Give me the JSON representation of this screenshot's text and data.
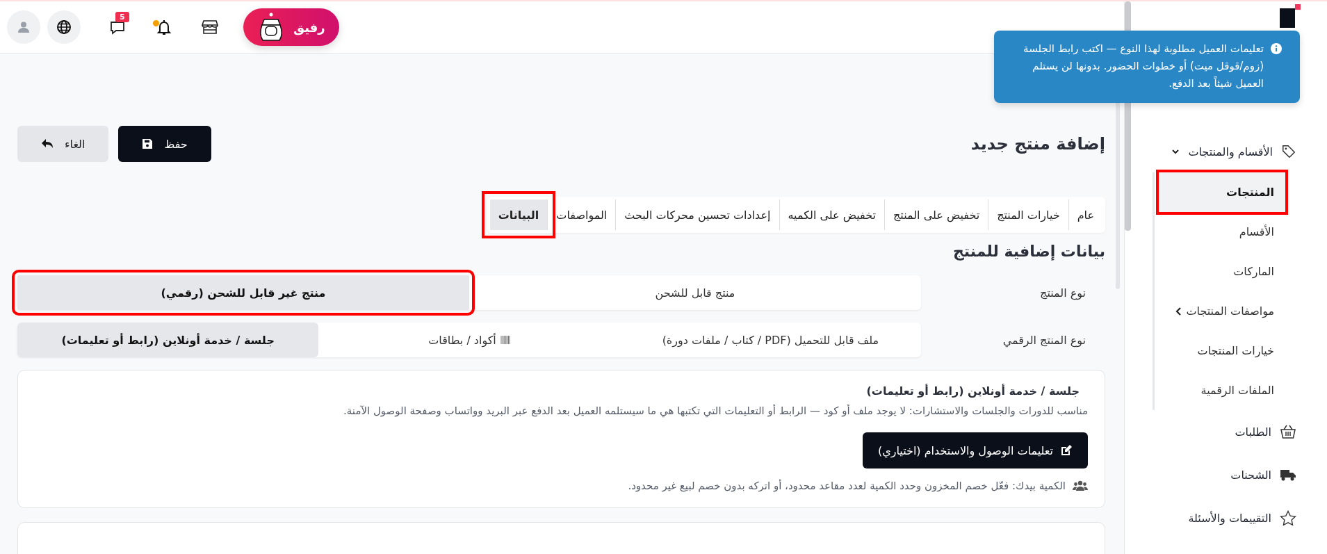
{
  "topbar": {
    "assistant": {
      "label": "رفيق"
    },
    "messages_badge": "5",
    "notification_dot": true
  },
  "sidebar": {
    "group": {
      "label": "الأقسام والمنتجات",
      "expanded": true
    },
    "subitems": [
      {
        "label": "المنتجات",
        "selected": true,
        "highlighted": true,
        "has_arrow": false
      },
      {
        "label": "الأقسام",
        "selected": false,
        "highlighted": false,
        "has_arrow": false
      },
      {
        "label": "الماركات",
        "selected": false,
        "highlighted": false,
        "has_arrow": false
      },
      {
        "label": "مواصفات المنتجات",
        "selected": false,
        "highlighted": false,
        "has_arrow": true
      },
      {
        "label": "خيارات المنتجات",
        "selected": false,
        "highlighted": false,
        "has_arrow": false
      },
      {
        "label": "الملفات الرقمية",
        "selected": false,
        "highlighted": false,
        "has_arrow": false
      }
    ],
    "items": [
      {
        "label": "الطلبات"
      },
      {
        "label": "الشحنات"
      },
      {
        "label": "التقييمات والأسئلة"
      }
    ]
  },
  "toast": {
    "text": "تعليمات العميل مطلوبة لهذا النوع — اكتب رابط الجلسة (زوم/قوقل ميت) أو خطوات الحضور. بدونها لن يستلم العميل شيئاً بعد الدفع."
  },
  "page": {
    "title": "إضافة منتج جديد",
    "buttons": [
      {
        "label": "حفظ",
        "kind": "primary"
      },
      {
        "label": "الغاء",
        "kind": "secondary"
      }
    ]
  },
  "tabs": [
    {
      "label": "عام",
      "selected": false,
      "highlighted": false
    },
    {
      "label": "خيارات المنتج",
      "selected": false,
      "highlighted": false
    },
    {
      "label": "تخفيض على المنتج",
      "selected": false,
      "highlighted": false
    },
    {
      "label": "تخفيض على الكميه",
      "selected": false,
      "highlighted": false
    },
    {
      "label": "إعدادات تحسين محركات البحث",
      "selected": false,
      "highlighted": false
    },
    {
      "label": "المواصفات",
      "selected": false,
      "highlighted": false
    },
    {
      "label": "البيانات",
      "selected": true,
      "highlighted": true
    }
  ],
  "section_title": "بيانات إضافية للمنتج",
  "form": [
    {
      "label": "نوع المنتج",
      "options": [
        {
          "label": "منتج قابل للشحن",
          "selected": false,
          "highlighted": false
        },
        {
          "label": "منتج غير قابل للشحن (رقمي)",
          "selected": true,
          "highlighted": true
        }
      ]
    },
    {
      "label": "نوع المنتج الرقمي",
      "options": [
        {
          "label": "ملف قابل للتحميل (PDF / كتاب / ملفات دورة)",
          "selected": false,
          "highlighted": false
        },
        {
          "label": "أكواد / بطاقات",
          "selected": false,
          "highlighted": false
        },
        {
          "label": "جلسة / خدمة أونلاين (رابط أو تعليمات)",
          "selected": true,
          "highlighted": false
        }
      ]
    }
  ],
  "card": {
    "title": "جلسة / خدمة أونلاين (رابط أو تعليمات)",
    "description": "مناسب للدورات والجلسات والاستشارات: لا يوجد ملف أو كود — الرابط أو التعليمات التي تكتبها هي ما سيستلمه العميل بعد الدفع عبر البريد وواتساب وصفحة الوصول الآمنة.",
    "button": "تعليمات الوصول والاستخدام (اختياري)",
    "note": "الكمية بيدك: فعّل خصم المخزون وحدد الكمية لعدد مقاعد محدود، أو اتركه بدون خصم لبيع غير محدود."
  }
}
